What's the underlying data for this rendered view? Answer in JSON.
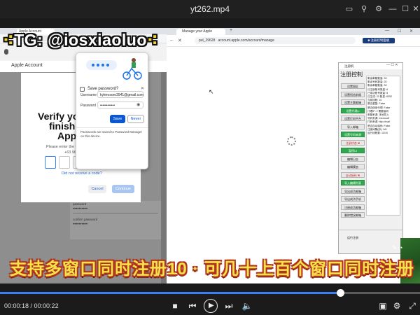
{
  "player": {
    "title": "yt262.mp4",
    "time_display": "00:00:18 / 00:00:22",
    "progress": 0.81,
    "window_controls": [
      "cast-icon",
      "pin-icon",
      "settings-icon",
      "minimize-icon",
      "maximize-icon",
      "close-icon"
    ]
  },
  "overlay": {
    "channel_tag": "TG: @iosxiaoluo",
    "subtitle": "支持多窗口同时注册10 · 可几十上百个窗口同时注册"
  },
  "left_browser": {
    "tab_title": "Apple Account",
    "page_header": "Apple Account",
    "dialog": {
      "heading_line1": "Verify your p",
      "heading_line2": "finish se",
      "heading_line3": "Apple",
      "instruction": "Please enter the verification code sent to",
      "phone": "+63 963 043 3941.",
      "resend_link": "Did not receive a code?",
      "cancel_label": "Cancel",
      "continue_label": "Continue"
    },
    "password_popup": {
      "title": "Save password?",
      "username_label": "Username",
      "username_value": "kylerosoro3941@gmail.com",
      "password_label": "Password",
      "password_value": "••••••••••••",
      "save_label": "Save",
      "never_label": "Never",
      "footer": "Passwords are saved to Password Manager on this device."
    },
    "background_fields": [
      {
        "label": "password",
        "value": "••••••••••"
      },
      {
        "label": "confirm password",
        "value": "••••••••••"
      }
    ]
  },
  "right_browser": {
    "tab_title": "Manage your Apple Account",
    "address_prefix": "pul_29628",
    "address": "account.apple.com/account/manage",
    "extension_label": "■ 注册控制面板"
  },
  "control_panel": {
    "window_title": "注册机",
    "heading": "注册控制",
    "buttons": [
      {
        "label": "设置国区",
        "style": "normal"
      },
      {
        "label": "设置短信前缀",
        "style": "normal"
      },
      {
        "label": "设置主题邮箱",
        "style": "normal"
      },
      {
        "label": "设置代理ip",
        "style": "green"
      },
      {
        "label": "设置打码平台",
        "style": "normal"
      },
      {
        "label": "导入邮箱",
        "style": "normal"
      },
      {
        "label": "设置号码来源",
        "style": "green"
      },
      {
        "label": "注册状态 ✖",
        "style": "red"
      },
      {
        "label": "暂停UI",
        "style": "green"
      },
      {
        "label": "编辑日志",
        "style": "normal"
      },
      {
        "label": "编辑模态",
        "style": "normal"
      },
      {
        "label": "自动接码 ✖",
        "style": "red"
      },
      {
        "label": "导入编辑列表",
        "style": "green"
      },
      {
        "label": "导出成功邮箱",
        "style": "normal"
      },
      {
        "label": "导出成功手机",
        "style": "normal"
      },
      {
        "label": "注册成功邮箱",
        "style": "normal"
      },
      {
        "label": "删除错误邮箱",
        "style": "normal"
      }
    ],
    "footer_label": "运行注册",
    "log_lines": [
      "剩余邮箱数量: 39",
      "剩余号码数量: 20",
      "剩余邮箱数量: 39",
      "已注册账号数量: 8",
      "已成功账号数量: 8",
      "已生成: 33  数量: 8352",
      "当前线程: 10",
      "是否重复: False",
      "是否使用代理: False",
      "代理IP: 2  需要接码",
      "邮箱来源: 本地导入",
      "号码来源: microsoft",
      "打码来源: http://mail",
      "是否自动接码: False",
      "注册间隔(秒): 5/8",
      "运行线程数: 10/10"
    ]
  }
}
